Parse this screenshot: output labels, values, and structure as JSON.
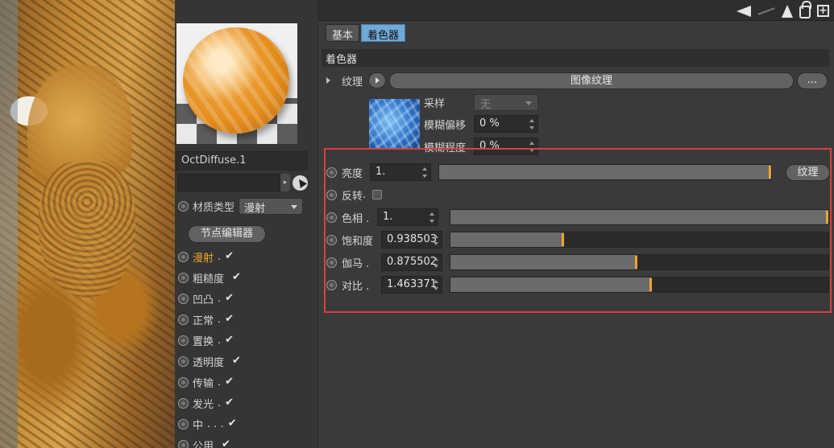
{
  "material": {
    "name": "OctDiffuse.1",
    "type_label": "材质类型",
    "type_value": "漫射",
    "node_editor_label": "节点编辑器"
  },
  "channels": [
    {
      "label": "漫射",
      "dots": " .",
      "checked": "✔",
      "active": true
    },
    {
      "label": "粗糙度",
      "dots": "",
      "checked": "✔",
      "active": false
    },
    {
      "label": "凹凸",
      "dots": " .",
      "checked": "✔",
      "active": false
    },
    {
      "label": "正常",
      "dots": " .",
      "checked": "✔",
      "active": false
    },
    {
      "label": "置换",
      "dots": " .",
      "checked": "✔",
      "active": false
    },
    {
      "label": "透明度",
      "dots": "",
      "checked": "✔",
      "active": false
    },
    {
      "label": "传输",
      "dots": " .",
      "checked": "✔",
      "active": false
    },
    {
      "label": "发光",
      "dots": " .",
      "checked": "✔",
      "active": false
    },
    {
      "label": "中",
      "dots": " . . .",
      "checked": "✔",
      "active": false
    },
    {
      "label": "公用",
      "dots": "",
      "checked": "✔",
      "active": false
    }
  ],
  "tabs": [
    {
      "label": "基本",
      "active": false
    },
    {
      "label": "着色器",
      "active": true
    }
  ],
  "section_title": "着色器",
  "texture": {
    "label": "纹理",
    "button_label": "图像纹理",
    "more_label": "..."
  },
  "sampling": {
    "label": "采样",
    "value": "无"
  },
  "blur_offset": {
    "label": "模糊偏移",
    "value": "0 %"
  },
  "blur_scale": {
    "label": "模糊程度",
    "value": "0 %"
  },
  "params": {
    "brightness": {
      "label": "亮度",
      "value": "1.",
      "fraction": 1.0,
      "tex_button": "纹理"
    },
    "invert": {
      "label": "反转",
      "dots": " ."
    },
    "hue": {
      "label": "色相",
      "dots": " .",
      "value": "1.",
      "fraction": 1.0
    },
    "saturation": {
      "label": "饱和度",
      "value": "0.938503",
      "fraction": 0.3
    },
    "gamma": {
      "label": "伽马",
      "dots": " .",
      "value": "0.875502",
      "fraction": 0.495
    },
    "contrast": {
      "label": "对比",
      "dots": " .",
      "value": "1.463371",
      "fraction": 0.533
    }
  },
  "colors": {
    "accent_active_tab": "#6fa9d8",
    "slider_knob": "#f2a32c",
    "active_channel": "#f0a32a",
    "highlight_box": "#d8413f"
  }
}
